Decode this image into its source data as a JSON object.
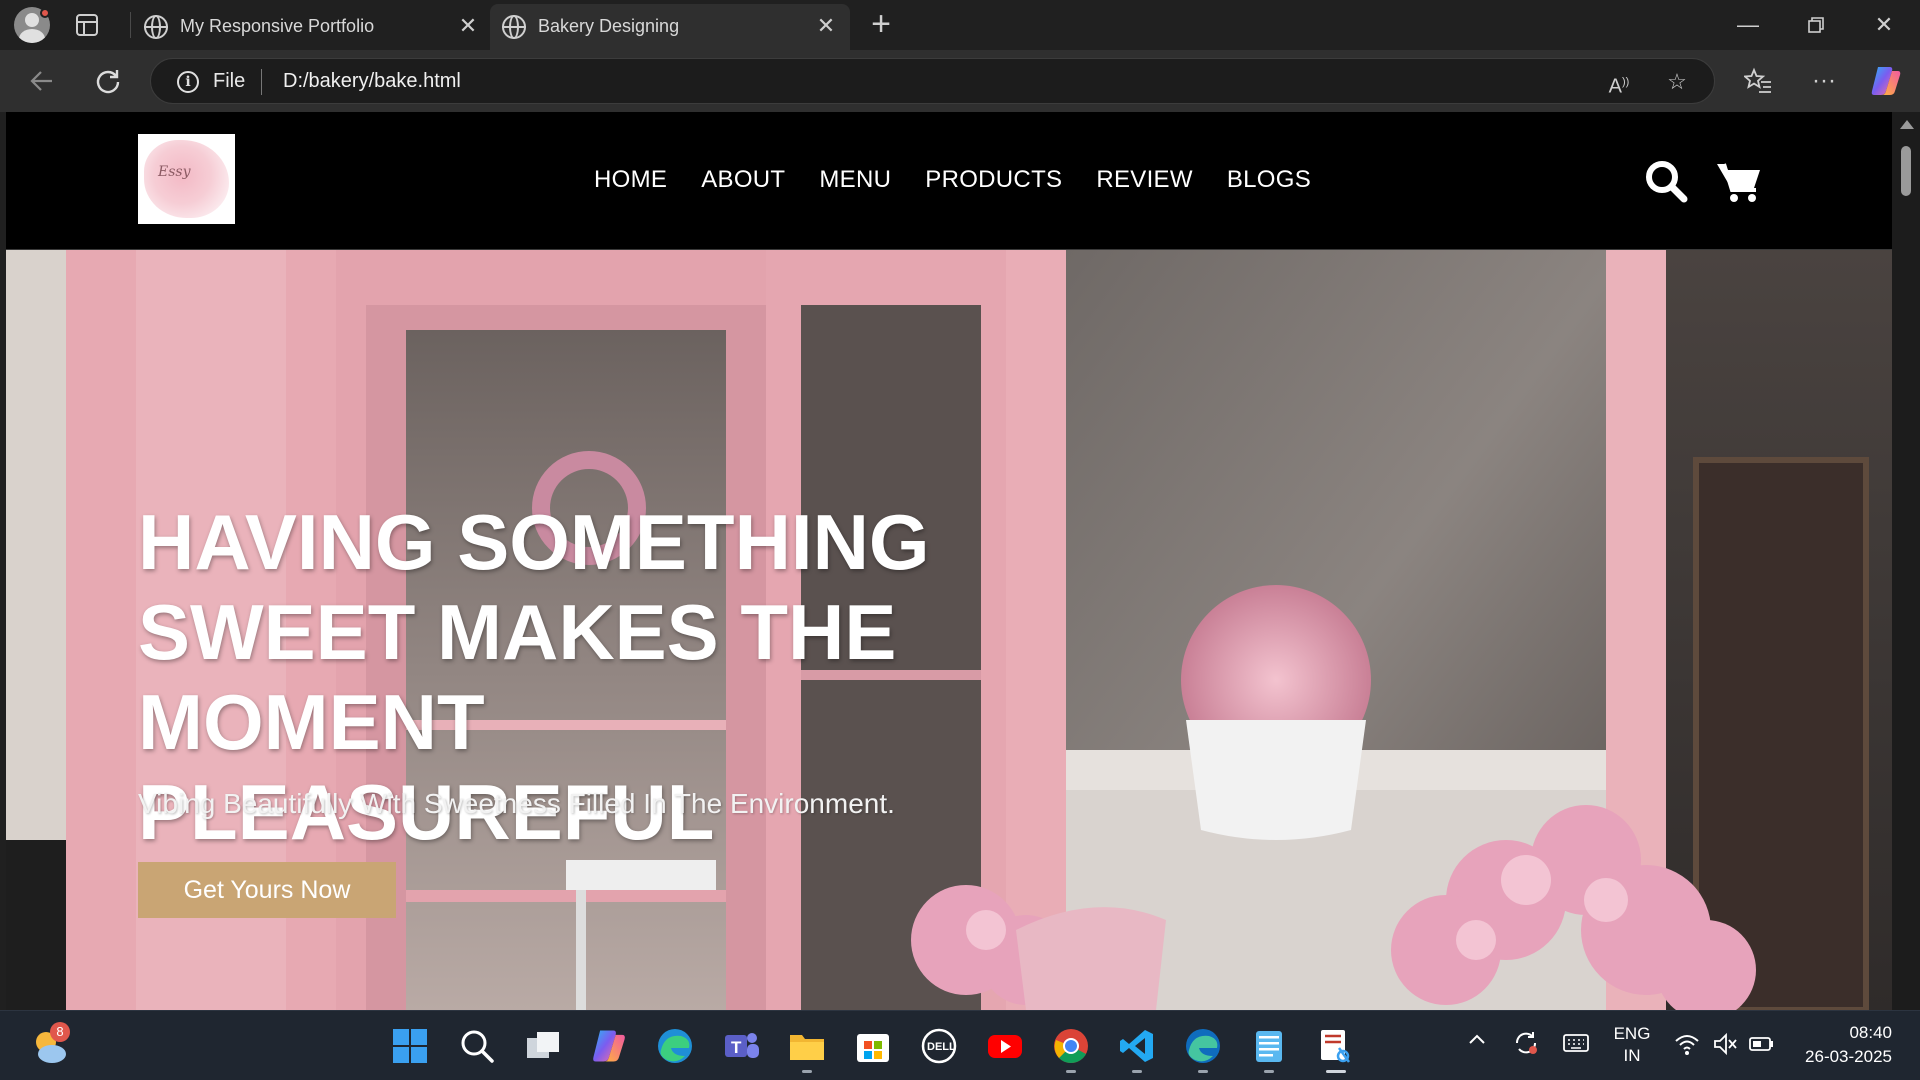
{
  "browser": {
    "tabs": [
      {
        "title": "My Responsive Portfolio",
        "active": false
      },
      {
        "title": "Bakery Designing",
        "active": true
      }
    ],
    "address": {
      "scheme_label": "File",
      "url": "D:/bakery/bake.html"
    },
    "icons": [
      "profile-icon",
      "tab-actions-icon",
      "globe-icon",
      "close-icon",
      "new-tab-icon",
      "minimize-icon",
      "restore-icon",
      "window-close-icon",
      "back-icon",
      "refresh-icon",
      "info-icon",
      "read-aloud-icon",
      "favorite-star-icon",
      "favorites-icon",
      "more-icon",
      "copilot-icon"
    ]
  },
  "site": {
    "logo_text": "Essy",
    "nav": [
      "HOME",
      "ABOUT",
      "MENU",
      "PRODUCTS",
      "REVIEW",
      "BLOGS"
    ],
    "header_icons": [
      "search-icon",
      "cart-icon"
    ],
    "hero": {
      "title_lines": [
        "HAVING SOMETHING",
        "SWEET MAKES THE",
        "MOMENT PLEASUREFUL"
      ],
      "subtitle": "Vibing Beautifully With Sweetness Filled In The Environment.",
      "button": "Get Yours Now"
    },
    "colors": {
      "header_bg": "#000000",
      "button_bg": "#c9a574",
      "storefront_pink": "#e8aab3"
    }
  },
  "taskbar": {
    "weather_badge": "8",
    "apps": [
      "start-icon",
      "search-icon",
      "task-view-icon",
      "copilot-icon",
      "edge-icon",
      "teams-icon",
      "file-explorer-icon",
      "microsoft-store-icon",
      "dell-icon",
      "youtube-icon",
      "chrome-icon",
      "vscode-icon",
      "edge-dev-icon",
      "notepad-icon",
      "snipping-tool-icon"
    ],
    "tray": {
      "lang_line1": "ENG",
      "lang_line2": "IN",
      "time": "08:40",
      "date": "26-03-2025"
    }
  }
}
